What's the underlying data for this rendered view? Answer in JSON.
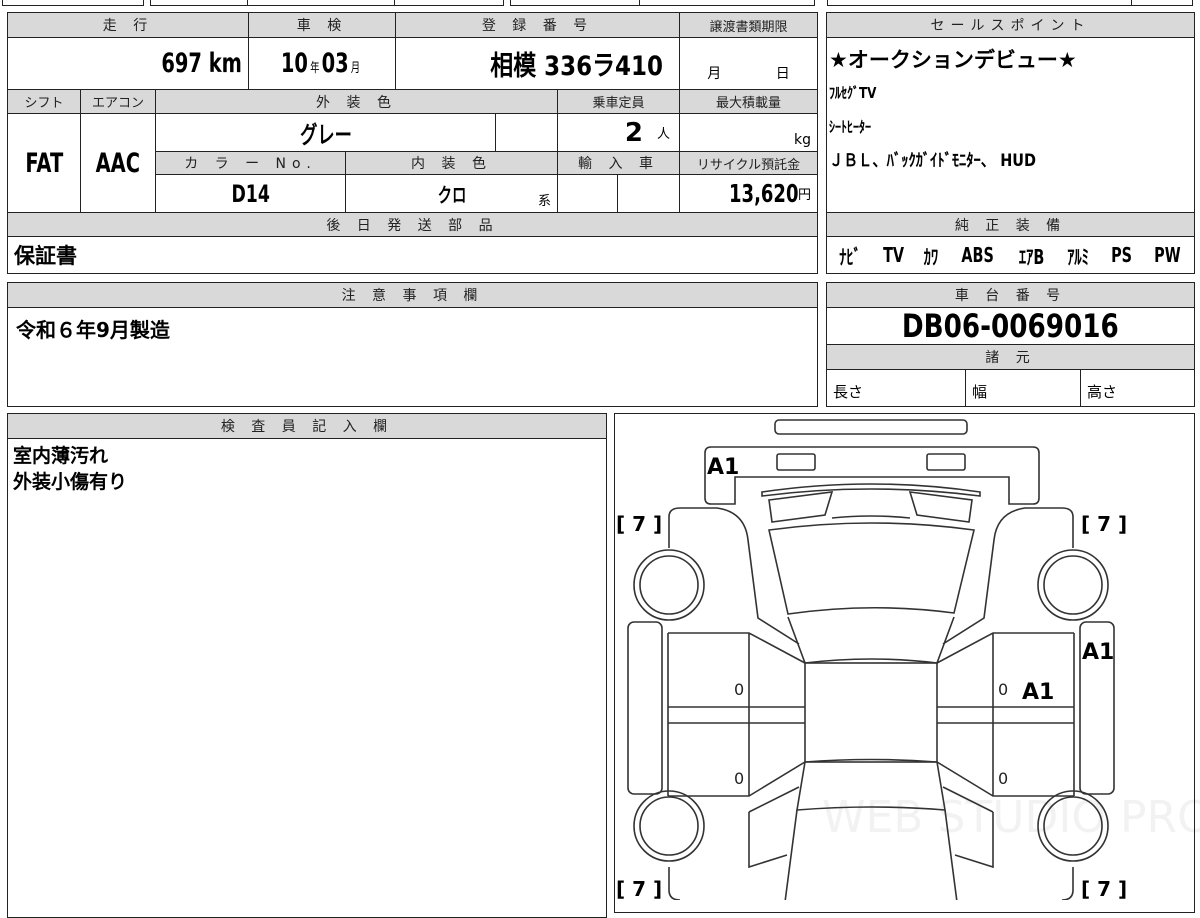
{
  "vehicle": {
    "mileage_label": "走 行",
    "mileage_value": "697",
    "mileage_unit": "km",
    "inspection_label": "車 検",
    "inspection_year": "10",
    "year_unit": "年",
    "inspection_month": "03",
    "month_unit": "月",
    "registration_label": "登 録 番 号",
    "registration_value": "相模 336ラ410",
    "transfer_deadline_label": "譲渡書類期限",
    "transfer_month_unit": "月",
    "transfer_day_unit": "日",
    "shift_label": "シフト",
    "shift_value": "FAT",
    "ac_label": "エアコン",
    "ac_value": "AAC",
    "exterior_color_label": "外 装 色",
    "exterior_color_value": "グレー",
    "capacity_label": "乗車定員",
    "capacity_value": "2",
    "capacity_unit": "人",
    "max_load_label": "最大積載量",
    "max_load_unit": "kg",
    "color_no_label": "カ ラ ー No.",
    "color_no_value": "D14",
    "interior_color_label": "内 装 色",
    "interior_color_value": "クロ",
    "interior_color_suffix": "系",
    "import_label": "輸 入 車",
    "recycle_label": "リサイクル預託金",
    "recycle_value": "13,620",
    "recycle_unit": "円",
    "later_parts_label": "後 日 発 送 部 品",
    "later_parts_value": "保証書"
  },
  "sales_points": {
    "label": "セールスポイント",
    "lines": [
      "★オークションデビュー★",
      "ﾌﾙｾｸﾞTV",
      "ｼｰﾄﾋｰﾀｰ",
      "ＪＢＬ、ﾊﾞｯｸｶﾞｲﾄﾞﾓﾆﾀｰ、 HUD"
    ]
  },
  "equipment": {
    "label": "純 正 装 備",
    "items": [
      "ﾅﾋﾞ",
      "TV",
      "ｶﾜ",
      "ABS",
      "ｴｱB",
      "ｱﾙﾐ",
      "PS",
      "PW"
    ]
  },
  "notes": {
    "label": "注 意 事 項 欄",
    "value": "令和６年9月製造"
  },
  "chassis": {
    "label": "車 台 番 号",
    "value": "DB06-0069016",
    "specs_label": "諸 元",
    "length_label": "長さ",
    "width_label": "幅",
    "height_label": "高さ"
  },
  "inspector": {
    "label": "検 査 員 記 入 欄",
    "lines": [
      "室内薄汚れ",
      "外装小傷有り"
    ]
  },
  "diagram": {
    "marks": {
      "rear": "A1",
      "right_sill": "A1",
      "right_door": "A1"
    },
    "tire_marks": [
      "[ 7 ]",
      "[ 7 ]",
      "[ 7 ]",
      "[ 7 ]"
    ],
    "door_zero": "0",
    "watermark": "WEB STUDIO PRO"
  }
}
